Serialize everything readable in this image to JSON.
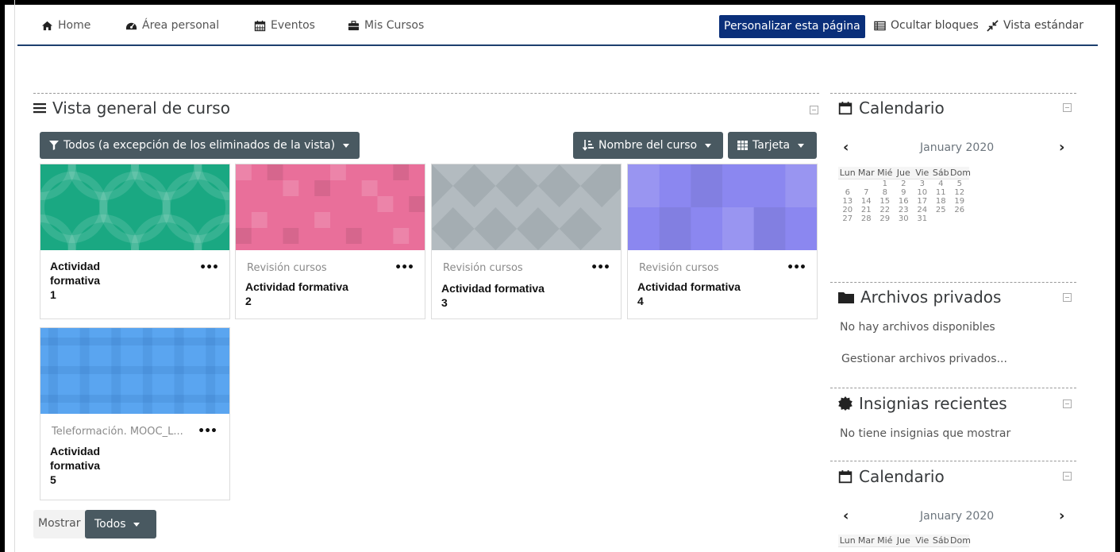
{
  "nav": {
    "home": "Home",
    "area_personal": "Área personal",
    "eventos": "Eventos",
    "mis_cursos": "Mis Cursos",
    "customize": "Personalizar esta página",
    "hide_blocks": "Ocultar bloques",
    "standard_view": "Vista estándar"
  },
  "overview": {
    "title": "Vista general de curso",
    "filter": "Todos (a excepción de los eliminados de la vista)",
    "sort": "Nombre del curso",
    "view": "Tarjeta",
    "show_label": "Mostrar",
    "show_value": "Todos"
  },
  "courses": [
    {
      "category": "",
      "name": "Actividad formativa 1",
      "line1": "Actividad",
      "line2": "formativa",
      "line3": "1",
      "color": "#1aa882"
    },
    {
      "category": "Revisión cursos",
      "name": "Actividad formativa 2",
      "line1": "Actividad formativa",
      "line2": "2",
      "color": "#e96f9a"
    },
    {
      "category": "Revisión cursos",
      "name": "Actividad formativa 3",
      "line1": "Actividad formativa",
      "line2": "3",
      "color": "#b3bbc0"
    },
    {
      "category": "Revisión cursos",
      "name": "Actividad formativa 4",
      "line1": "Actividad formativa",
      "line2": "4",
      "color": "#8b87f0"
    },
    {
      "category": "Teleformación. MOOC_L...",
      "name": "Actividad formativa 5",
      "line1": "Actividad",
      "line2": "formativa",
      "line3": "5",
      "color": "#5aa5f0"
    }
  ],
  "calendar": {
    "title": "Calendario",
    "month": "January 2020",
    "days": [
      "Lun",
      "Mar",
      "Mié",
      "Jue",
      "Vie",
      "Sáb",
      "Dom"
    ],
    "weeks": [
      [
        "",
        "",
        "1",
        "2",
        "3",
        "4",
        "5"
      ],
      [
        "6",
        "7",
        "8",
        "9",
        "10",
        "11",
        "12"
      ],
      [
        "13",
        "14",
        "15",
        "16",
        "17",
        "18",
        "19"
      ],
      [
        "20",
        "21",
        "22",
        "23",
        "24",
        "25",
        "26"
      ],
      [
        "27",
        "28",
        "29",
        "30",
        "31",
        "",
        ""
      ]
    ]
  },
  "private_files": {
    "title": "Archivos privados",
    "empty": "No hay archivos disponibles",
    "manage": "Gestionar archivos privados..."
  },
  "badges": {
    "title": "Insignias recientes",
    "empty": "No tiene insignias que mostrar"
  },
  "calendar2": {
    "title": "Calendario",
    "month": "January 2020",
    "days": [
      "Lun",
      "Mar",
      "Mié",
      "Jue",
      "Vie",
      "Sáb",
      "Dom"
    ]
  },
  "colors": {
    "nav_border": "#1d3f6e",
    "customize_bg": "#0a2f7a",
    "button_dark": "#495961"
  }
}
